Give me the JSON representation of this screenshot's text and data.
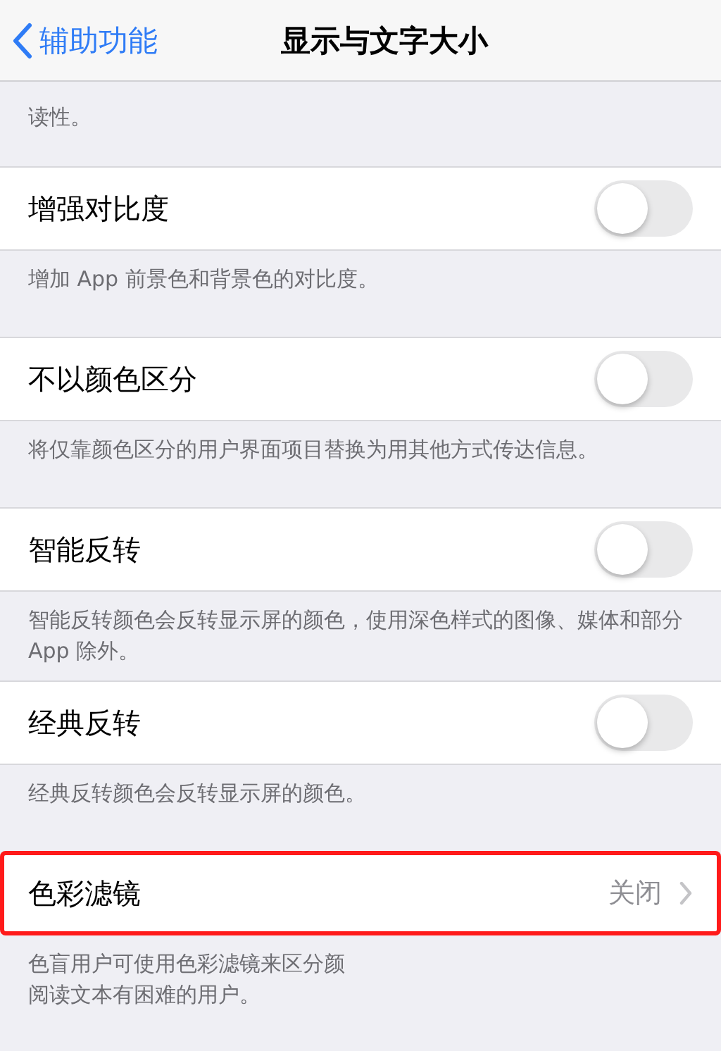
{
  "nav": {
    "back": "辅助功能",
    "title": "显示与文字大小"
  },
  "top_note": "读性。",
  "sections": [
    {
      "kind": "toggle",
      "label": "增强对比度",
      "on": false,
      "highlighted": false,
      "footer": [
        "增加 App 前景色和背景色的对比度。"
      ]
    },
    {
      "kind": "toggle",
      "label": "不以颜色区分",
      "on": false,
      "highlighted": false,
      "footer": [
        "将仅靠颜色区分的用户界面项目替换为用其他方式传达信息。"
      ]
    },
    {
      "kind": "toggle",
      "label": "智能反转",
      "on": false,
      "highlighted": false,
      "footer": [
        "智能反转颜色会反转显示屏的颜色，使用深色样式的图像、媒体和部分 App 除外。"
      ]
    },
    {
      "kind": "toggle",
      "label": "经典反转",
      "on": false,
      "highlighted": false,
      "footer": [
        "经典反转颜色会反转显示屏的颜色。"
      ]
    },
    {
      "kind": "link",
      "label": "色彩滤镜",
      "value": "关闭",
      "highlighted": true,
      "footer": [
        "色盲用户可使用色彩滤镜来区分颜",
        "阅读文本有困难的用户。"
      ]
    }
  ]
}
